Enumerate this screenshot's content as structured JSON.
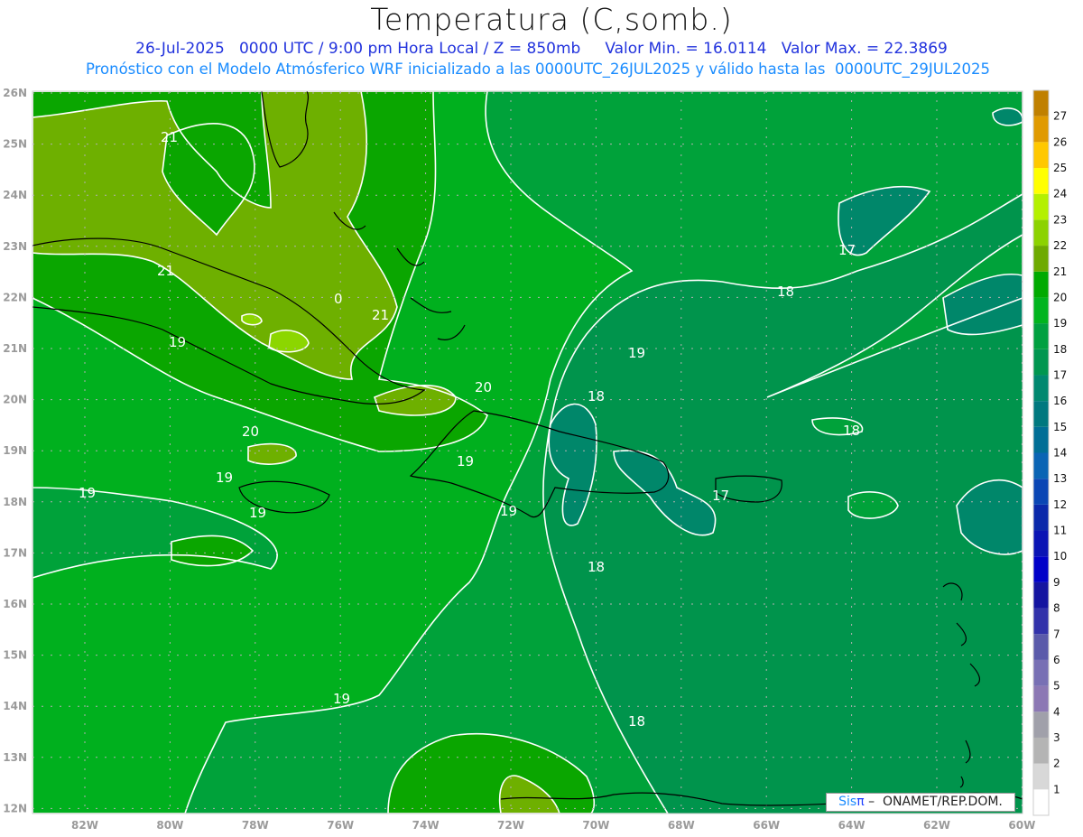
{
  "title": "Temperatura (C,somb.)",
  "subtitle_line1": "26-Jul-2025   0000 UTC / 9:00 pm Hora Local / Z = 850mb     Valor Min. = 16.0114   Valor Max. = 22.3869",
  "subtitle_line2": "Pronóstico con el Modelo Atmósferico WRF inicializado a las 0000UTC_26JUL2025 y válido hasta las  0000UTC_29JUL2025",
  "credit": {
    "sis": "Sis",
    "pi": "π",
    "rest": " –  ONAMET/REP.DOM."
  },
  "axes": {
    "lat_labels": [
      "26N",
      "25N",
      "24N",
      "23N",
      "22N",
      "21N",
      "20N",
      "19N",
      "18N",
      "17N",
      "16N",
      "15N",
      "14N",
      "13N",
      "12N"
    ],
    "lon_labels": [
      "82W",
      "80W",
      "78W",
      "76W",
      "74W",
      "72W",
      "70W",
      "68W",
      "66W",
      "64W",
      "62W",
      "60W"
    ]
  },
  "colorbar": {
    "labels": [
      "1",
      "2",
      "3",
      "4",
      "5",
      "6",
      "7",
      "8",
      "9",
      "10",
      "11",
      "12",
      "13",
      "14",
      "15",
      "16",
      "17",
      "18",
      "19",
      "20",
      "21",
      "22",
      "23",
      "24",
      "25",
      "26",
      "27"
    ],
    "colors": [
      "#ffffff",
      "#d8d8d8",
      "#b4b4b4",
      "#a0a0aa",
      "#8c78b4",
      "#7870b4",
      "#5a5aaa",
      "#3232aa",
      "#1414a0",
      "#0000c8",
      "#0a14b4",
      "#0a28aa",
      "#0a46b4",
      "#0a64b4",
      "#006e96",
      "#00787f",
      "#008870",
      "#009650",
      "#00a040",
      "#00b41e",
      "#00aa00",
      "#6eaa00",
      "#8cd200",
      "#b4f000",
      "#ffff00",
      "#ffc800",
      "#e09a00",
      "#c08000"
    ]
  },
  "map": {
    "colors": {
      "c16": "#00876a",
      "c17": "#00944c",
      "c18": "#00a23a",
      "c19": "#00b01e",
      "c20": "#0aa600",
      "c21": "#6eb000",
      "c22": "#8cd600"
    },
    "contour_labels": [
      "21",
      "21",
      "0",
      "21",
      "19",
      "20",
      "20",
      "19",
      "19",
      "19",
      "19",
      "19",
      "18",
      "19",
      "18",
      "17",
      "18",
      "17",
      "18",
      "19",
      "18"
    ]
  }
}
